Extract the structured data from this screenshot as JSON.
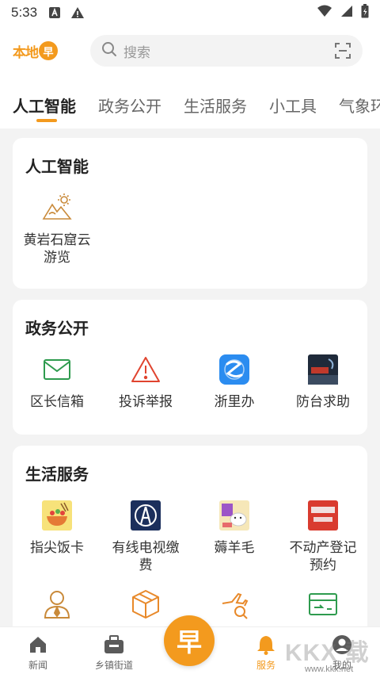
{
  "status_bar": {
    "time": "5:33"
  },
  "header": {
    "logo_text": "本地",
    "logo_badge": "早",
    "search_placeholder": "搜索"
  },
  "tabs": [
    {
      "label": "人工智能",
      "active": true
    },
    {
      "label": "政务公开"
    },
    {
      "label": "生活服务"
    },
    {
      "label": "小工具"
    },
    {
      "label": "气象环"
    }
  ],
  "sections": [
    {
      "title": "人工智能",
      "items": [
        {
          "label": "黄岩石窟云游览",
          "icon": "mountain-sun-icon"
        }
      ]
    },
    {
      "title": "政务公开",
      "items": [
        {
          "label": "区长信箱",
          "icon": "mail-icon"
        },
        {
          "label": "投诉举报",
          "icon": "warning-icon"
        },
        {
          "label": "浙里办",
          "icon": "zheliban-app-icon"
        },
        {
          "label": "防台求助",
          "icon": "typhoon-help-icon",
          "badge_text": "防台风 求助平台"
        }
      ]
    },
    {
      "title": "生活服务",
      "items": [
        {
          "label": "指尖饭卡",
          "icon": "food-bowl-icon"
        },
        {
          "label": "有线电视缴费",
          "icon": "cable-tv-icon"
        },
        {
          "label": "薅羊毛",
          "icon": "sheep-deals-icon"
        },
        {
          "label": "不动产登记预约",
          "icon": "real-estate-icon",
          "badge_text": "不动产 登记预约"
        },
        {
          "label": "",
          "icon": "person-service-icon"
        },
        {
          "label": "",
          "icon": "package-icon"
        },
        {
          "label": "",
          "icon": "flight-search-icon"
        },
        {
          "label": "",
          "icon": "card-icon"
        }
      ]
    }
  ],
  "bottom_nav": [
    {
      "label": "新闻",
      "icon": "home-icon"
    },
    {
      "label": "乡镇街道",
      "icon": "briefcase-icon"
    },
    {
      "label": "早",
      "icon": "center-logo-icon"
    },
    {
      "label": "服务",
      "icon": "bell-icon",
      "active": true
    },
    {
      "label": "我的",
      "icon": "user-icon"
    }
  ],
  "watermark": {
    "text": "KKX 载",
    "sub": "www.kkx.net"
  },
  "colors": {
    "accent": "#f39a1e",
    "green": "#2e9b4e",
    "blue": "#2b8cf0",
    "red": "#e0442f"
  }
}
